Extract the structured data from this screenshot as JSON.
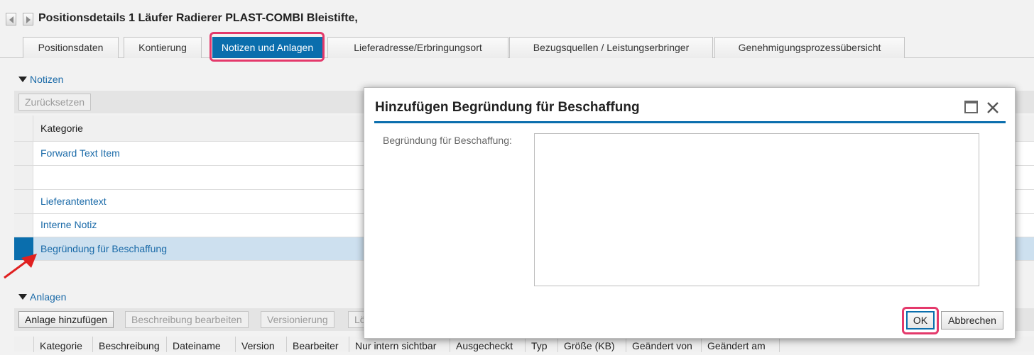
{
  "header": {
    "title": "Positionsdetails 1  Läufer Radierer PLAST-COMBI Bleistifte,"
  },
  "tabs": [
    {
      "label": "Positionsdaten"
    },
    {
      "label": "Kontierung"
    },
    {
      "label": "Notizen und Anlagen"
    },
    {
      "label": "Lieferadresse/Erbringungsort"
    },
    {
      "label": "Bezugsquellen / Leistungserbringer"
    },
    {
      "label": "Genehmigungsprozessübersicht"
    }
  ],
  "notes": {
    "section_title": "Notizen",
    "reset_button": "Zurücksetzen",
    "column_header": "Kategorie",
    "rows": [
      {
        "label": "Forward Text Item"
      },
      {
        "label": ""
      },
      {
        "label": "Lieferantentext"
      },
      {
        "label": "Interne Notiz"
      },
      {
        "label": "Begründung für Beschaffung"
      }
    ]
  },
  "attachments": {
    "section_title": "Anlagen",
    "buttons": {
      "add": "Anlage hinzufügen",
      "edit_description": "Beschreibung bearbeiten",
      "versioning": "Versionierung",
      "lo": "Lö"
    },
    "columns": [
      "Kategorie",
      "Beschreibung",
      "Dateiname",
      "Version",
      "Bearbeiter",
      "Nur intern sichtbar",
      "Ausgecheckt",
      "Typ",
      "Größe (KB)",
      "Geändert von",
      "Geändert am"
    ]
  },
  "dialog": {
    "title": "Hinzufügen Begründung für Beschaffung",
    "field_label": "Begründung für Beschaffung:",
    "field_value": "",
    "ok_button": "OK",
    "cancel_button": "Abbrechen"
  },
  "colors": {
    "accent": "#0a6ead",
    "highlight": "#e4396b",
    "link": "#1a6aa8"
  }
}
